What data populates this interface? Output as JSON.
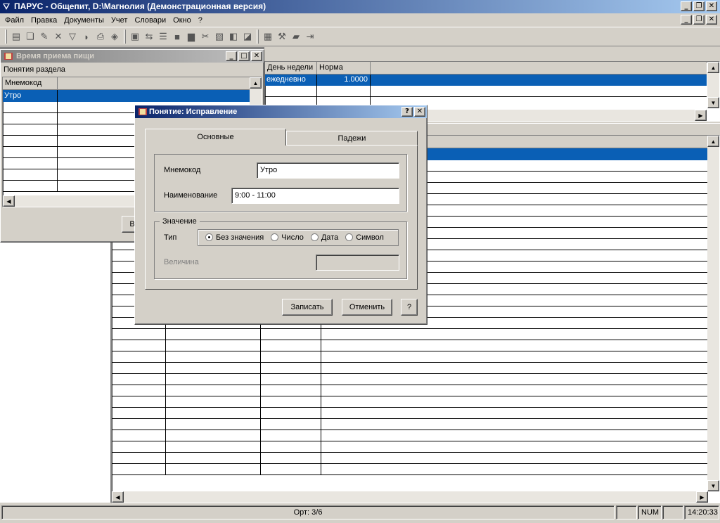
{
  "app": {
    "title": "ПАРУС - Общепит, D:\\Магнолия (Демонстрационная версия)"
  },
  "menu": {
    "items": [
      "Файл",
      "Правка",
      "Документы",
      "Учет",
      "Словари",
      "Окно",
      "?"
    ]
  },
  "icons": {
    "toolbar_group1": [
      "new-doc-icon",
      "copy-doc-icon",
      "edit-doc-icon",
      "delete-icon",
      "filter-icon",
      "mark-icon",
      "print-icon",
      "package-icon"
    ],
    "toolbar_group2": [
      "view-icon",
      "move-icon",
      "list-icon",
      "folder-dark-icon",
      "folder-icon",
      "tools-icon",
      "paste-icon",
      "book-icon",
      "users-icon"
    ],
    "toolbar_group3": [
      "calculator-icon",
      "hammer-icon",
      "folder-open-icon",
      "exit-icon"
    ]
  },
  "rates_panel": {
    "columns": [
      "День недели",
      "Норма"
    ],
    "rows": [
      {
        "day": "ежедневно",
        "norm": "1.0000"
      }
    ]
  },
  "meal_window": {
    "title": "Время приема пищи",
    "section_label": "Понятия раздела",
    "column": "Мнемокод",
    "rows": [
      "Утро"
    ],
    "partial_button": "В"
  },
  "dialog": {
    "title": "Понятие: Исправление",
    "tabs": [
      "Основные",
      "Падежи"
    ],
    "mnemo_label": "Мнемокод",
    "mnemo_value": "Утро",
    "name_label": "Наименование",
    "name_value": "9:00 - 11:00",
    "value_group": "Значение",
    "type_label": "Тип",
    "type_options": [
      "Без значения",
      "Число",
      "Дата",
      "Символ"
    ],
    "type_selected": "Без значения",
    "magnitude_label": "Величина",
    "magnitude_value": "",
    "save_button": "Записать",
    "cancel_button": "Отменить",
    "help_button": "?"
  },
  "status": {
    "record": "Орт: 3/6",
    "num": "NUM",
    "time": "14:20:33"
  },
  "colors": {
    "title_active": "#0a246a",
    "selection": "#0a5fb5"
  }
}
